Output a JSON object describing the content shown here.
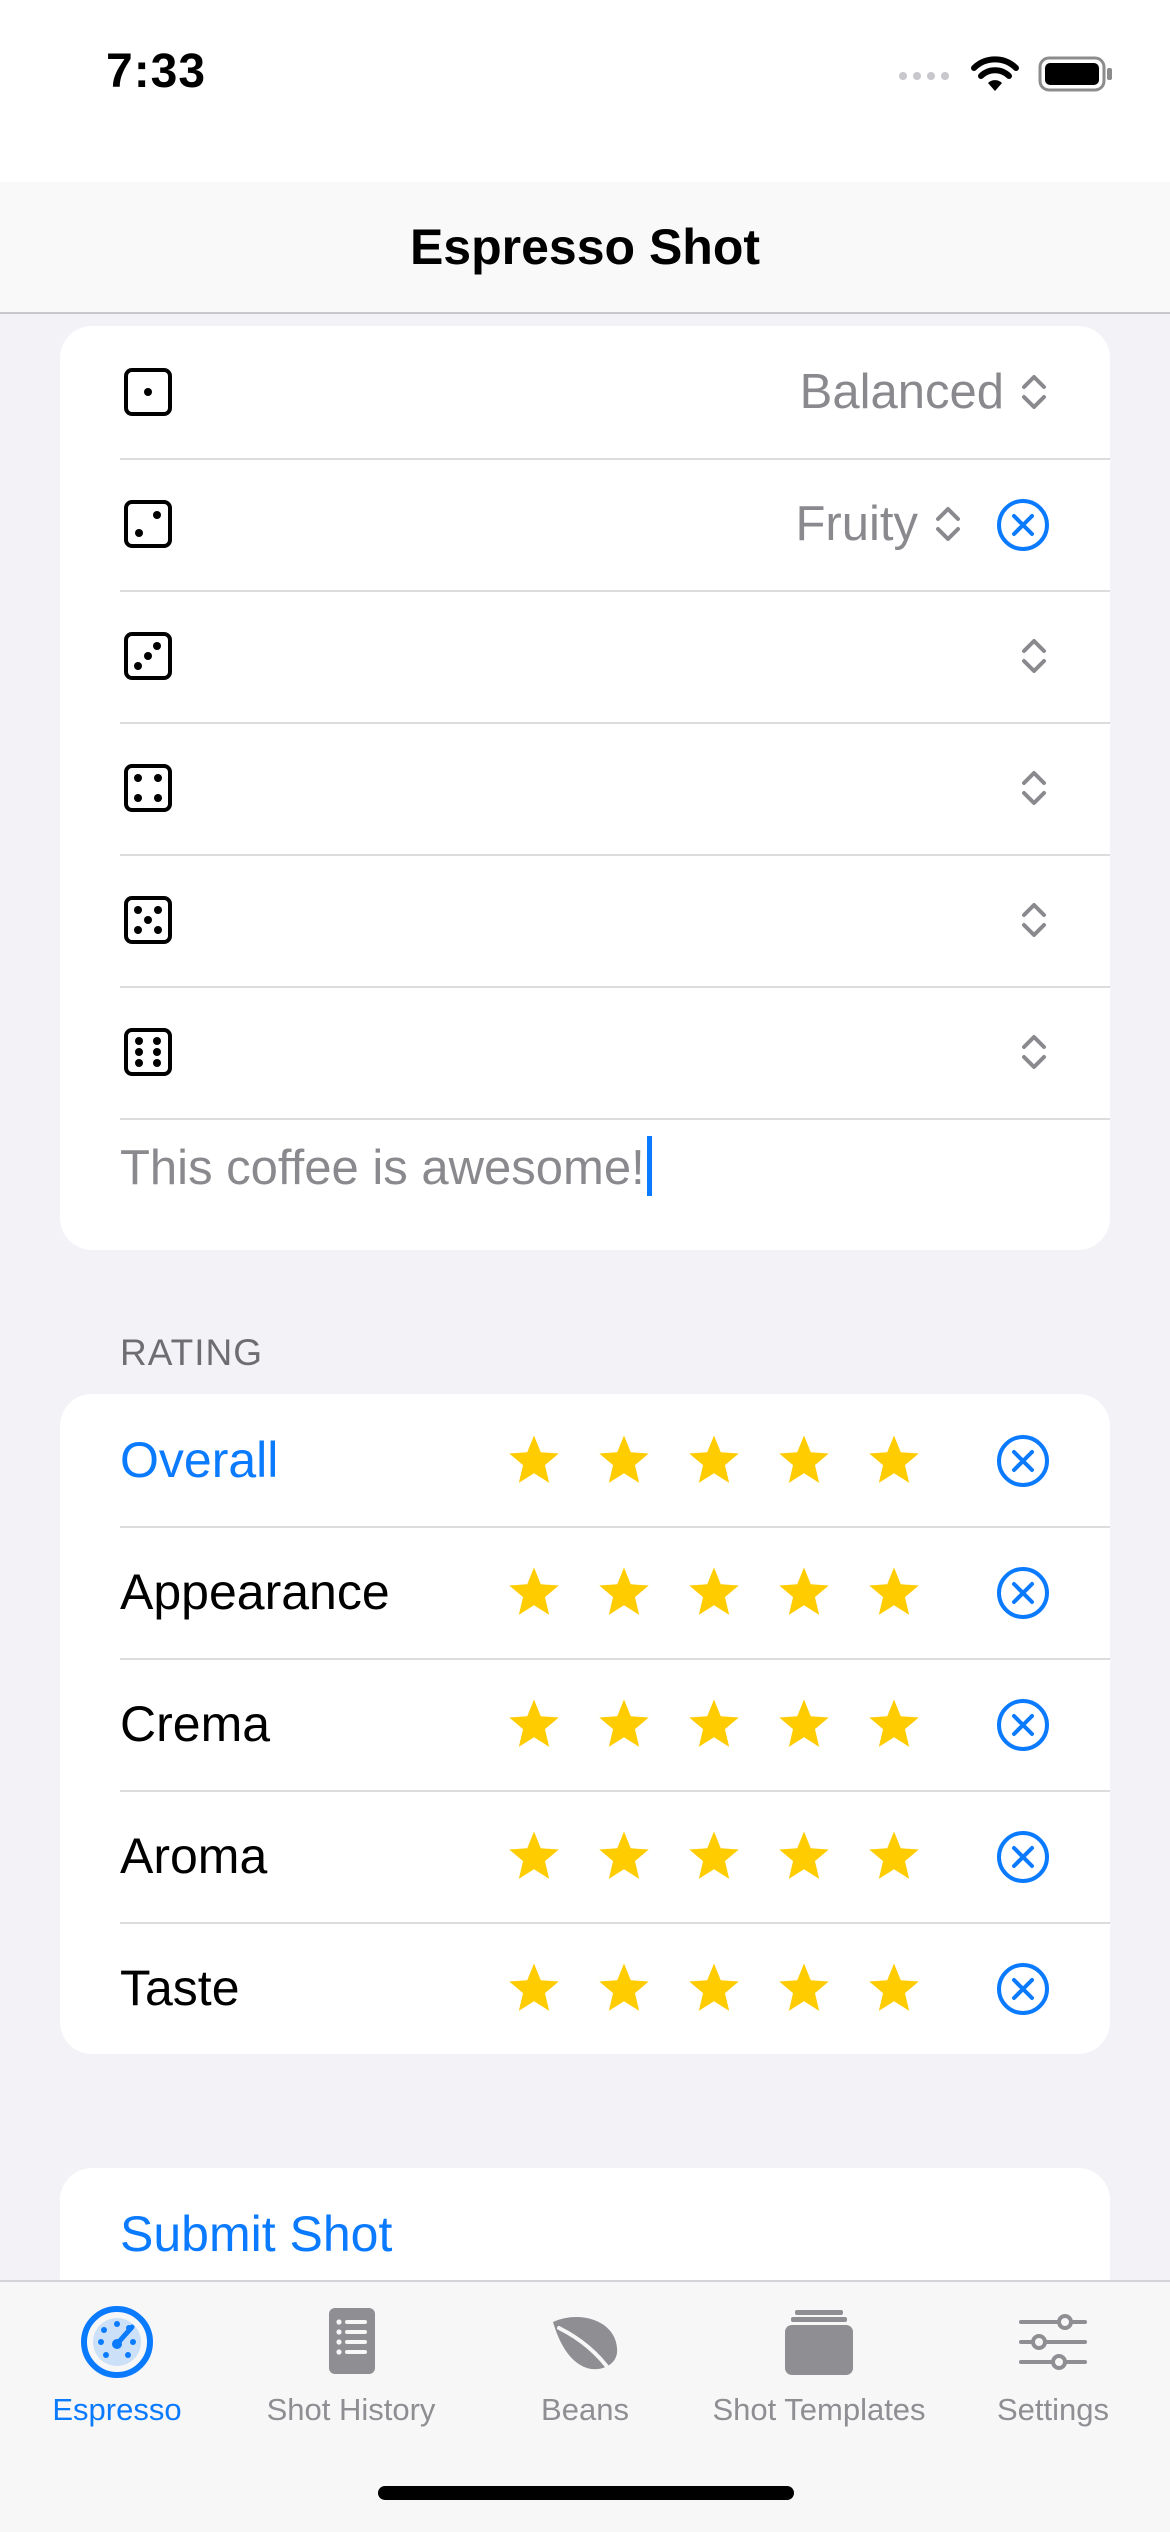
{
  "status": {
    "time": "7:33"
  },
  "nav": {
    "title": "Espresso Shot"
  },
  "flavors": {
    "rows": [
      {
        "icon": "die-face-1-icon",
        "value": "Balanced",
        "clearable": false
      },
      {
        "icon": "die-face-2-icon",
        "value": "Fruity",
        "clearable": true
      },
      {
        "icon": "die-face-3-icon",
        "value": "",
        "clearable": false
      },
      {
        "icon": "die-face-4-icon",
        "value": "",
        "clearable": false
      },
      {
        "icon": "die-face-5-icon",
        "value": "",
        "clearable": false
      },
      {
        "icon": "die-face-6-icon",
        "value": "",
        "clearable": false
      }
    ],
    "notes_value": "This coffee is awesome!"
  },
  "rating": {
    "header": "RATING",
    "rows": [
      {
        "label": "Overall",
        "stars": 5,
        "max": 5,
        "accent": true
      },
      {
        "label": "Appearance",
        "stars": 5,
        "max": 5,
        "accent": false
      },
      {
        "label": "Crema",
        "stars": 5,
        "max": 5,
        "accent": false
      },
      {
        "label": "Aroma",
        "stars": 5,
        "max": 5,
        "accent": false
      },
      {
        "label": "Taste",
        "stars": 5,
        "max": 5,
        "accent": false
      }
    ]
  },
  "submit": {
    "label": "Submit Shot"
  },
  "tabs": [
    {
      "label": "Espresso",
      "icon": "gauge-icon",
      "active": true
    },
    {
      "label": "Shot History",
      "icon": "list-document-icon",
      "active": false
    },
    {
      "label": "Beans",
      "icon": "leaf-icon",
      "active": false
    },
    {
      "label": "Shot Templates",
      "icon": "stacked-folder-icon",
      "active": false
    },
    {
      "label": "Settings",
      "icon": "sliders-icon",
      "active": false
    }
  ],
  "colors": {
    "accent": "#0a7aff",
    "star": "#ffcc00",
    "secondary_text": "#8a8a8e",
    "background": "#f2f2f7"
  }
}
